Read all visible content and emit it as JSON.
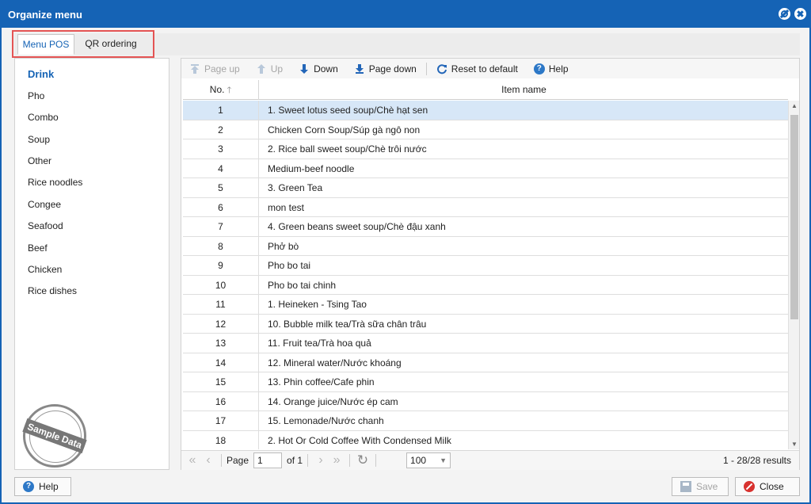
{
  "window": {
    "title": "Organize menu"
  },
  "tabs": [
    {
      "label": "Menu POS"
    },
    {
      "label": "QR ordering"
    }
  ],
  "categories": [
    {
      "label": "Drink"
    },
    {
      "label": "Pho"
    },
    {
      "label": "Combo"
    },
    {
      "label": "Soup"
    },
    {
      "label": "Other"
    },
    {
      "label": "Rice noodles"
    },
    {
      "label": "Congee"
    },
    {
      "label": "Seafood"
    },
    {
      "label": "Beef"
    },
    {
      "label": "Chicken"
    },
    {
      "label": "Rice dishes"
    }
  ],
  "stamp": {
    "text": "Sample Data"
  },
  "toolbar": {
    "page_up": "Page up",
    "up": "Up",
    "down": "Down",
    "page_down": "Page down",
    "reset": "Reset to default",
    "help": "Help"
  },
  "grid": {
    "col_no": "No.",
    "col_name": "Item name",
    "rows": [
      {
        "no": "1",
        "name": "1. Sweet lotus seed soup/Chè hạt sen"
      },
      {
        "no": "2",
        "name": "Chicken Corn Soup/Súp gà ngô non"
      },
      {
        "no": "3",
        "name": "2. Rice ball sweet soup/Chè trôi nước"
      },
      {
        "no": "4",
        "name": "Medium-beef noodle"
      },
      {
        "no": "5",
        "name": "3. Green Tea"
      },
      {
        "no": "6",
        "name": "mon test"
      },
      {
        "no": "7",
        "name": "4. Green beans sweet soup/Chè đậu xanh"
      },
      {
        "no": "8",
        "name": "Phở bò"
      },
      {
        "no": "9",
        "name": "Pho bo tai"
      },
      {
        "no": "10",
        "name": "Pho bo tai chinh"
      },
      {
        "no": "11",
        "name": "1. Heineken - Tsing Tao"
      },
      {
        "no": "12",
        "name": "10. Bubble milk tea/Trà sữa chân trâu"
      },
      {
        "no": "13",
        "name": "11. Fruit tea/Trà hoa quả"
      },
      {
        "no": "14",
        "name": "12. Mineral water/Nước khoáng"
      },
      {
        "no": "15",
        "name": "13. Phin coffee/Cafe phin"
      },
      {
        "no": "16",
        "name": "14. Orange juice/Nước ép cam"
      },
      {
        "no": "17",
        "name": "15. Lemonade/Nước chanh"
      },
      {
        "no": "18",
        "name": "2. Hot Or Cold Coffee With Condensed Milk"
      }
    ]
  },
  "pager": {
    "page_label": "Page",
    "page_value": "1",
    "of_label": "of 1",
    "page_size": "100",
    "results": "1 - 28/28 results"
  },
  "footer": {
    "help": "Help",
    "save": "Save",
    "close": "Close"
  },
  "colors": {
    "accent": "#1563b5",
    "selected_row": "#d7e7f7",
    "tab_highlight": "#e45454"
  }
}
